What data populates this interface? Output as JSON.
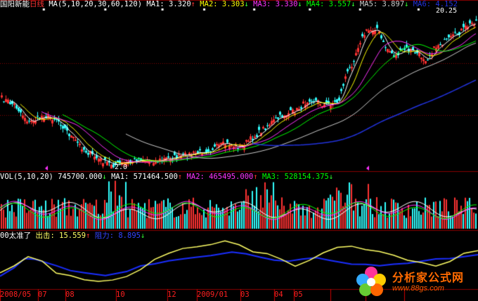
{
  "colors": {
    "ma1": "#ffffff",
    "ma2": "#ffff00",
    "ma3": "#ff33ff",
    "ma4": "#00ff00",
    "ma5": "#cccccc",
    "ma6": "#2233dd",
    "up": "#ff3333",
    "down": "#33ffff",
    "grid": "#8a0000",
    "vol_up": "#ff3333",
    "vol_down": "#33ffff",
    "ind_yellow": "#ffff66",
    "ind_blue": "#1a2eff"
  },
  "price_panel": {
    "title": "国阳新能",
    "period": "日线",
    "ma_params": "MA(5,10,20,30,60,120)",
    "ma1": "MA1: 3.320",
    "ma1_arrow": "↑",
    "ma2": "MA2: 3.303",
    "ma2_arrow": "↓",
    "ma3": "MA3: 3.330",
    "ma3_arrow": "↓",
    "ma4": "MA4: 3.557",
    "ma4_arrow": "↓",
    "ma5": "MA5: 3.897",
    "ma5_arrow": "↓",
    "ma6": "MA6: 4.152",
    "high_label": "20.25",
    "low_label": "2.0"
  },
  "volume_panel": {
    "params": "VOL(5,10,20)",
    "vol": "745700.000",
    "vol_arrow": "↓",
    "ma1": "MA1: 571464.500",
    "ma1_arrow": "↑",
    "ma2": "MA2: 465495.000",
    "ma2_arrow": "↑",
    "ma3": "MA3: 528154.375",
    "ma3_arrow": "↓"
  },
  "indicator_panel": {
    "name": "00太准了",
    "out_label": "出击: 15.559",
    "out_arrow": "↑",
    "resist_label": "阻力: 8.895",
    "resist_arrow": "↓"
  },
  "x_axis": [
    "2008/05",
    "07",
    "08",
    "10",
    "12",
    "2009/01",
    "03",
    "04",
    "05"
  ],
  "watermark": {
    "brand": "分析家公式网",
    "url": "www.88gs.com"
  }
}
